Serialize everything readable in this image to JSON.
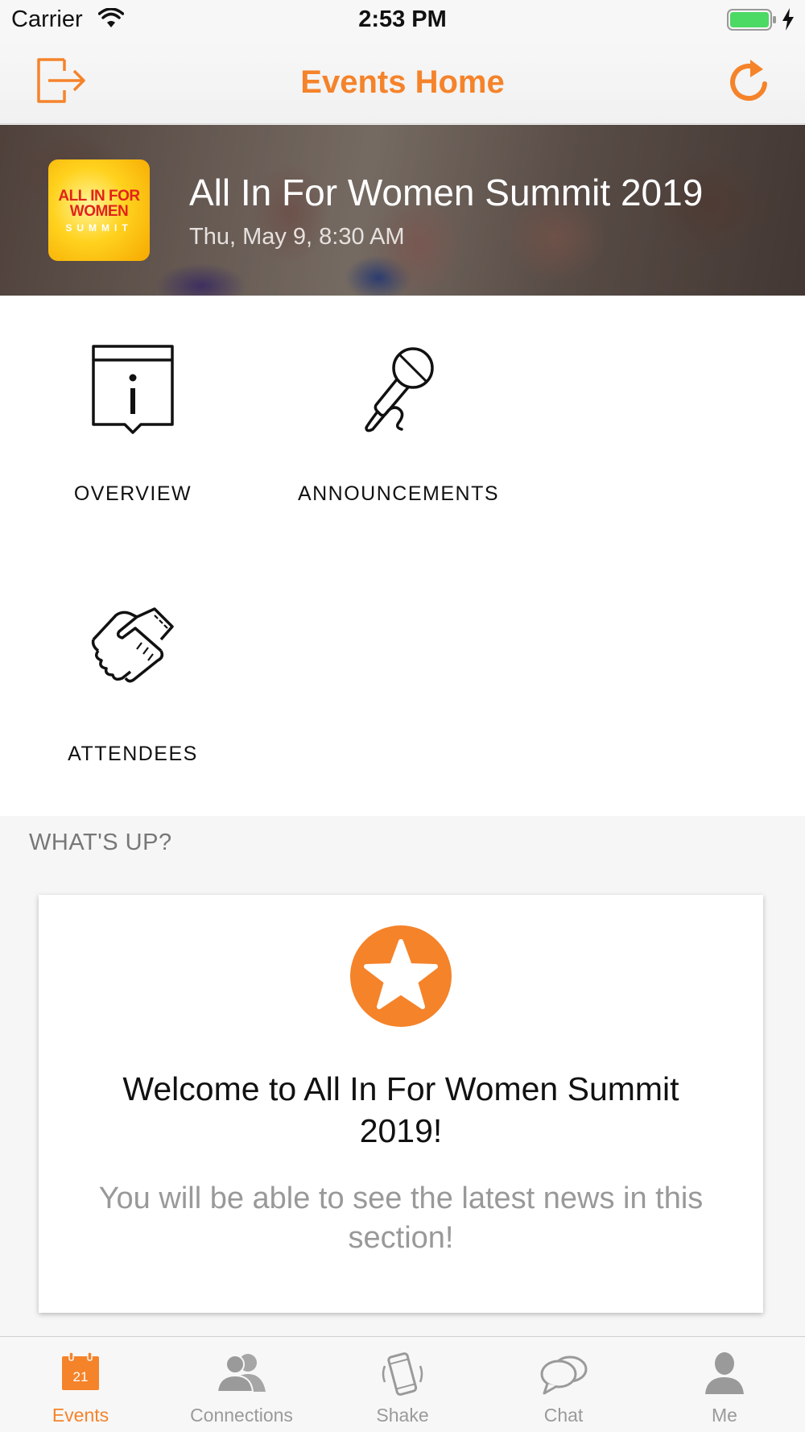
{
  "status_bar": {
    "carrier": "Carrier",
    "time": "2:53 PM"
  },
  "nav": {
    "title": "Events Home",
    "left_icon": "logout-icon",
    "right_icon": "refresh-icon"
  },
  "event": {
    "logo_text": [
      "ALL IN FOR",
      "WOMEN",
      "SUMMIT"
    ],
    "title": "All In For Women Summit 2019",
    "datetime": "Thu, May 9, 8:30 AM"
  },
  "tiles": [
    {
      "label": "OVERVIEW",
      "icon": "info-icon"
    },
    {
      "label": "ANNOUNCEMENTS",
      "icon": "microphone-icon"
    },
    {
      "label": "ATTENDEES",
      "icon": "handshake-icon"
    }
  ],
  "whats_up": {
    "heading": "WHAT'S UP?",
    "card_title": "Welcome to All In For Women Summit 2019!",
    "card_body": "You will be able to see the latest news in this section!",
    "card_icon": "star-icon"
  },
  "tab_bar": {
    "active": "Events",
    "calendar_day": "21",
    "tabs": [
      {
        "label": "Events",
        "icon": "calendar-icon"
      },
      {
        "label": "Connections",
        "icon": "people-icon"
      },
      {
        "label": "Shake",
        "icon": "phone-shake-icon"
      },
      {
        "label": "Chat",
        "icon": "chat-icon"
      },
      {
        "label": "Me",
        "icon": "person-icon"
      }
    ]
  },
  "colors": {
    "accent": "#f5832a",
    "tab_inactive": "#9a9a9a",
    "battery": "#4cd964"
  }
}
